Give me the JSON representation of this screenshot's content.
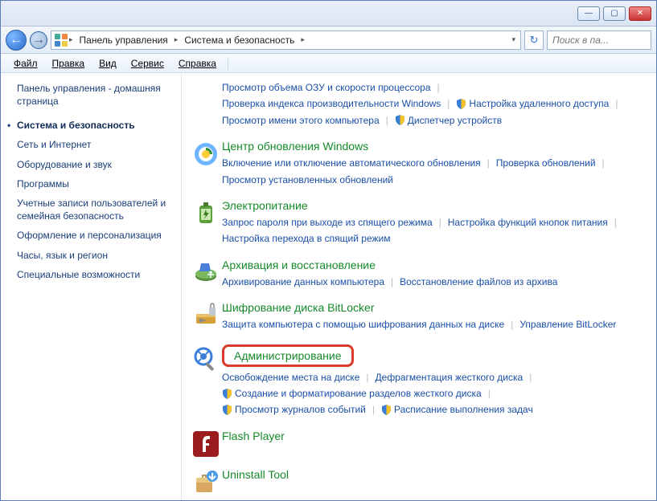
{
  "titlebar": {
    "minimize": "—",
    "maximize": "▢",
    "close": "✕"
  },
  "nav": {
    "back": "←",
    "forward": "→",
    "refresh": "↻"
  },
  "breadcrumb": {
    "root_label": "Панель управления",
    "section_label": "Система и безопасность"
  },
  "search": {
    "placeholder": "Поиск в па..."
  },
  "menubar": {
    "file": "Файл",
    "edit": "Правка",
    "view": "Вид",
    "tools": "Сервис",
    "help": "Справка"
  },
  "sidebar": {
    "home": "Панель управления - домашняя страница",
    "items": [
      {
        "label": "Система и безопасность",
        "active": true
      },
      {
        "label": "Сеть и Интернет"
      },
      {
        "label": "Оборудование и звук"
      },
      {
        "label": "Программы"
      },
      {
        "label": "Учетные записи пользователей и семейная безопасность"
      },
      {
        "label": "Оформление и персонализация"
      },
      {
        "label": "Часы, язык и регион"
      },
      {
        "label": "Специальные возможности"
      }
    ]
  },
  "content": {
    "top_links": [
      {
        "label": "Просмотр объема ОЗУ и скорости процессора"
      },
      {
        "label": "Проверка индекса производительности Windows"
      },
      {
        "label": "Настройка удаленного доступа",
        "shield": true
      },
      {
        "label": "Просмотр имени этого компьютера"
      },
      {
        "label": "Диспетчер устройств",
        "shield": true
      }
    ],
    "categories": [
      {
        "id": "windows-update",
        "title": "Центр обновления Windows",
        "links": [
          {
            "label": "Включение или отключение автоматического обновления"
          },
          {
            "label": "Проверка обновлений"
          },
          {
            "label": "Просмотр установленных обновлений"
          }
        ]
      },
      {
        "id": "power",
        "title": "Электропитание",
        "links": [
          {
            "label": "Запрос пароля при выходе из спящего режима"
          },
          {
            "label": "Настройка функций кнопок питания"
          },
          {
            "label": "Настройка перехода в спящий режим"
          }
        ]
      },
      {
        "id": "backup",
        "title": "Архивация и восстановление",
        "links": [
          {
            "label": "Архивирование данных компьютера"
          },
          {
            "label": "Восстановление файлов из архива"
          }
        ]
      },
      {
        "id": "bitlocker",
        "title": "Шифрование диска BitLocker",
        "links": [
          {
            "label": "Защита компьютера с помощью шифрования данных на диске"
          },
          {
            "label": "Управление BitLocker"
          }
        ]
      },
      {
        "id": "admin",
        "title": "Администрирование",
        "highlight": true,
        "links": [
          {
            "label": "Освобождение места на диске"
          },
          {
            "label": "Дефрагментация жесткого диска"
          },
          {
            "label": "Создание и форматирование разделов жесткого диска",
            "shield": true
          },
          {
            "label": "Просмотр журналов событий",
            "shield": true
          },
          {
            "label": "Расписание выполнения задач",
            "shield": true
          }
        ]
      },
      {
        "id": "flash",
        "title": "Flash Player",
        "links": []
      },
      {
        "id": "uninstall",
        "title": "Uninstall Tool",
        "links": []
      }
    ]
  }
}
